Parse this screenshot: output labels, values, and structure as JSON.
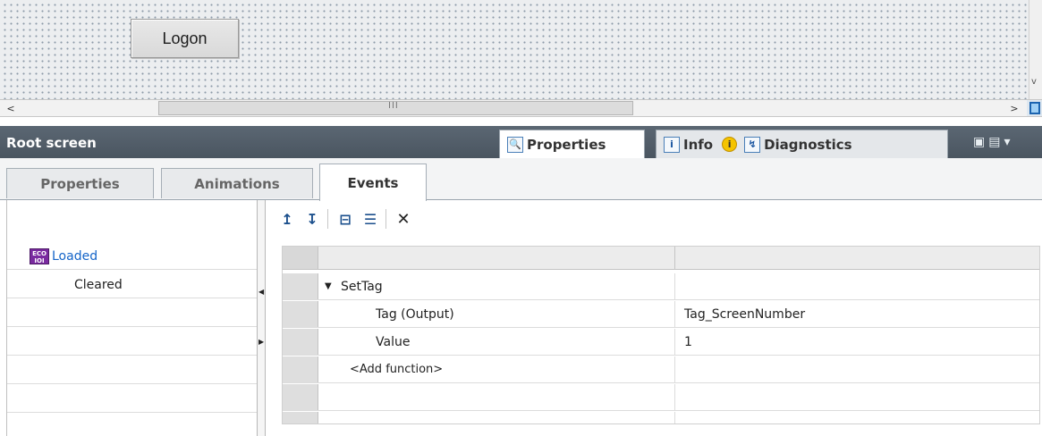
{
  "canvas": {
    "logon_button_label": "Logon",
    "hscroll_grip": "III",
    "hscroll_left": "<",
    "hscroll_right": ">",
    "vscroll_down": "v"
  },
  "inspector": {
    "title": "Root screen",
    "tabs": [
      {
        "label": "Properties",
        "icon": "magnifier-icon"
      },
      {
        "label": "Info",
        "icon": "info-tab-icon"
      },
      {
        "label": "Diagnostics",
        "icon": "diagnostics-icon"
      }
    ],
    "info_badge": "i"
  },
  "subtabs": [
    {
      "label": "Properties"
    },
    {
      "label": "Animations"
    },
    {
      "label": "Events",
      "active": true
    }
  ],
  "events": [
    {
      "label": "Loaded",
      "selected": true,
      "icon": "event-icon",
      "icon_text": "ECO IOI"
    },
    {
      "label": "Cleared",
      "selected": false
    }
  ],
  "toolbar": {
    "buttons": [
      {
        "name": "move-up",
        "glyph": "↥"
      },
      {
        "name": "move-down",
        "glyph": "↧"
      },
      {
        "name": "expand-all",
        "glyph": "⊟"
      },
      {
        "name": "collapse-all",
        "glyph": "☰"
      },
      {
        "name": "delete",
        "glyph": "✕"
      }
    ]
  },
  "function_list": {
    "function": "SetTag",
    "params": [
      {
        "name": "Tag (Output)",
        "value": "Tag_ScreenNumber"
      },
      {
        "name": "Value",
        "value": "1"
      }
    ],
    "add_function": "<Add function>"
  },
  "colors": {
    "inspector_bar": "#4f5a65",
    "selected_event": "#1464c8",
    "canvas_dot": "#8c9aa8"
  }
}
